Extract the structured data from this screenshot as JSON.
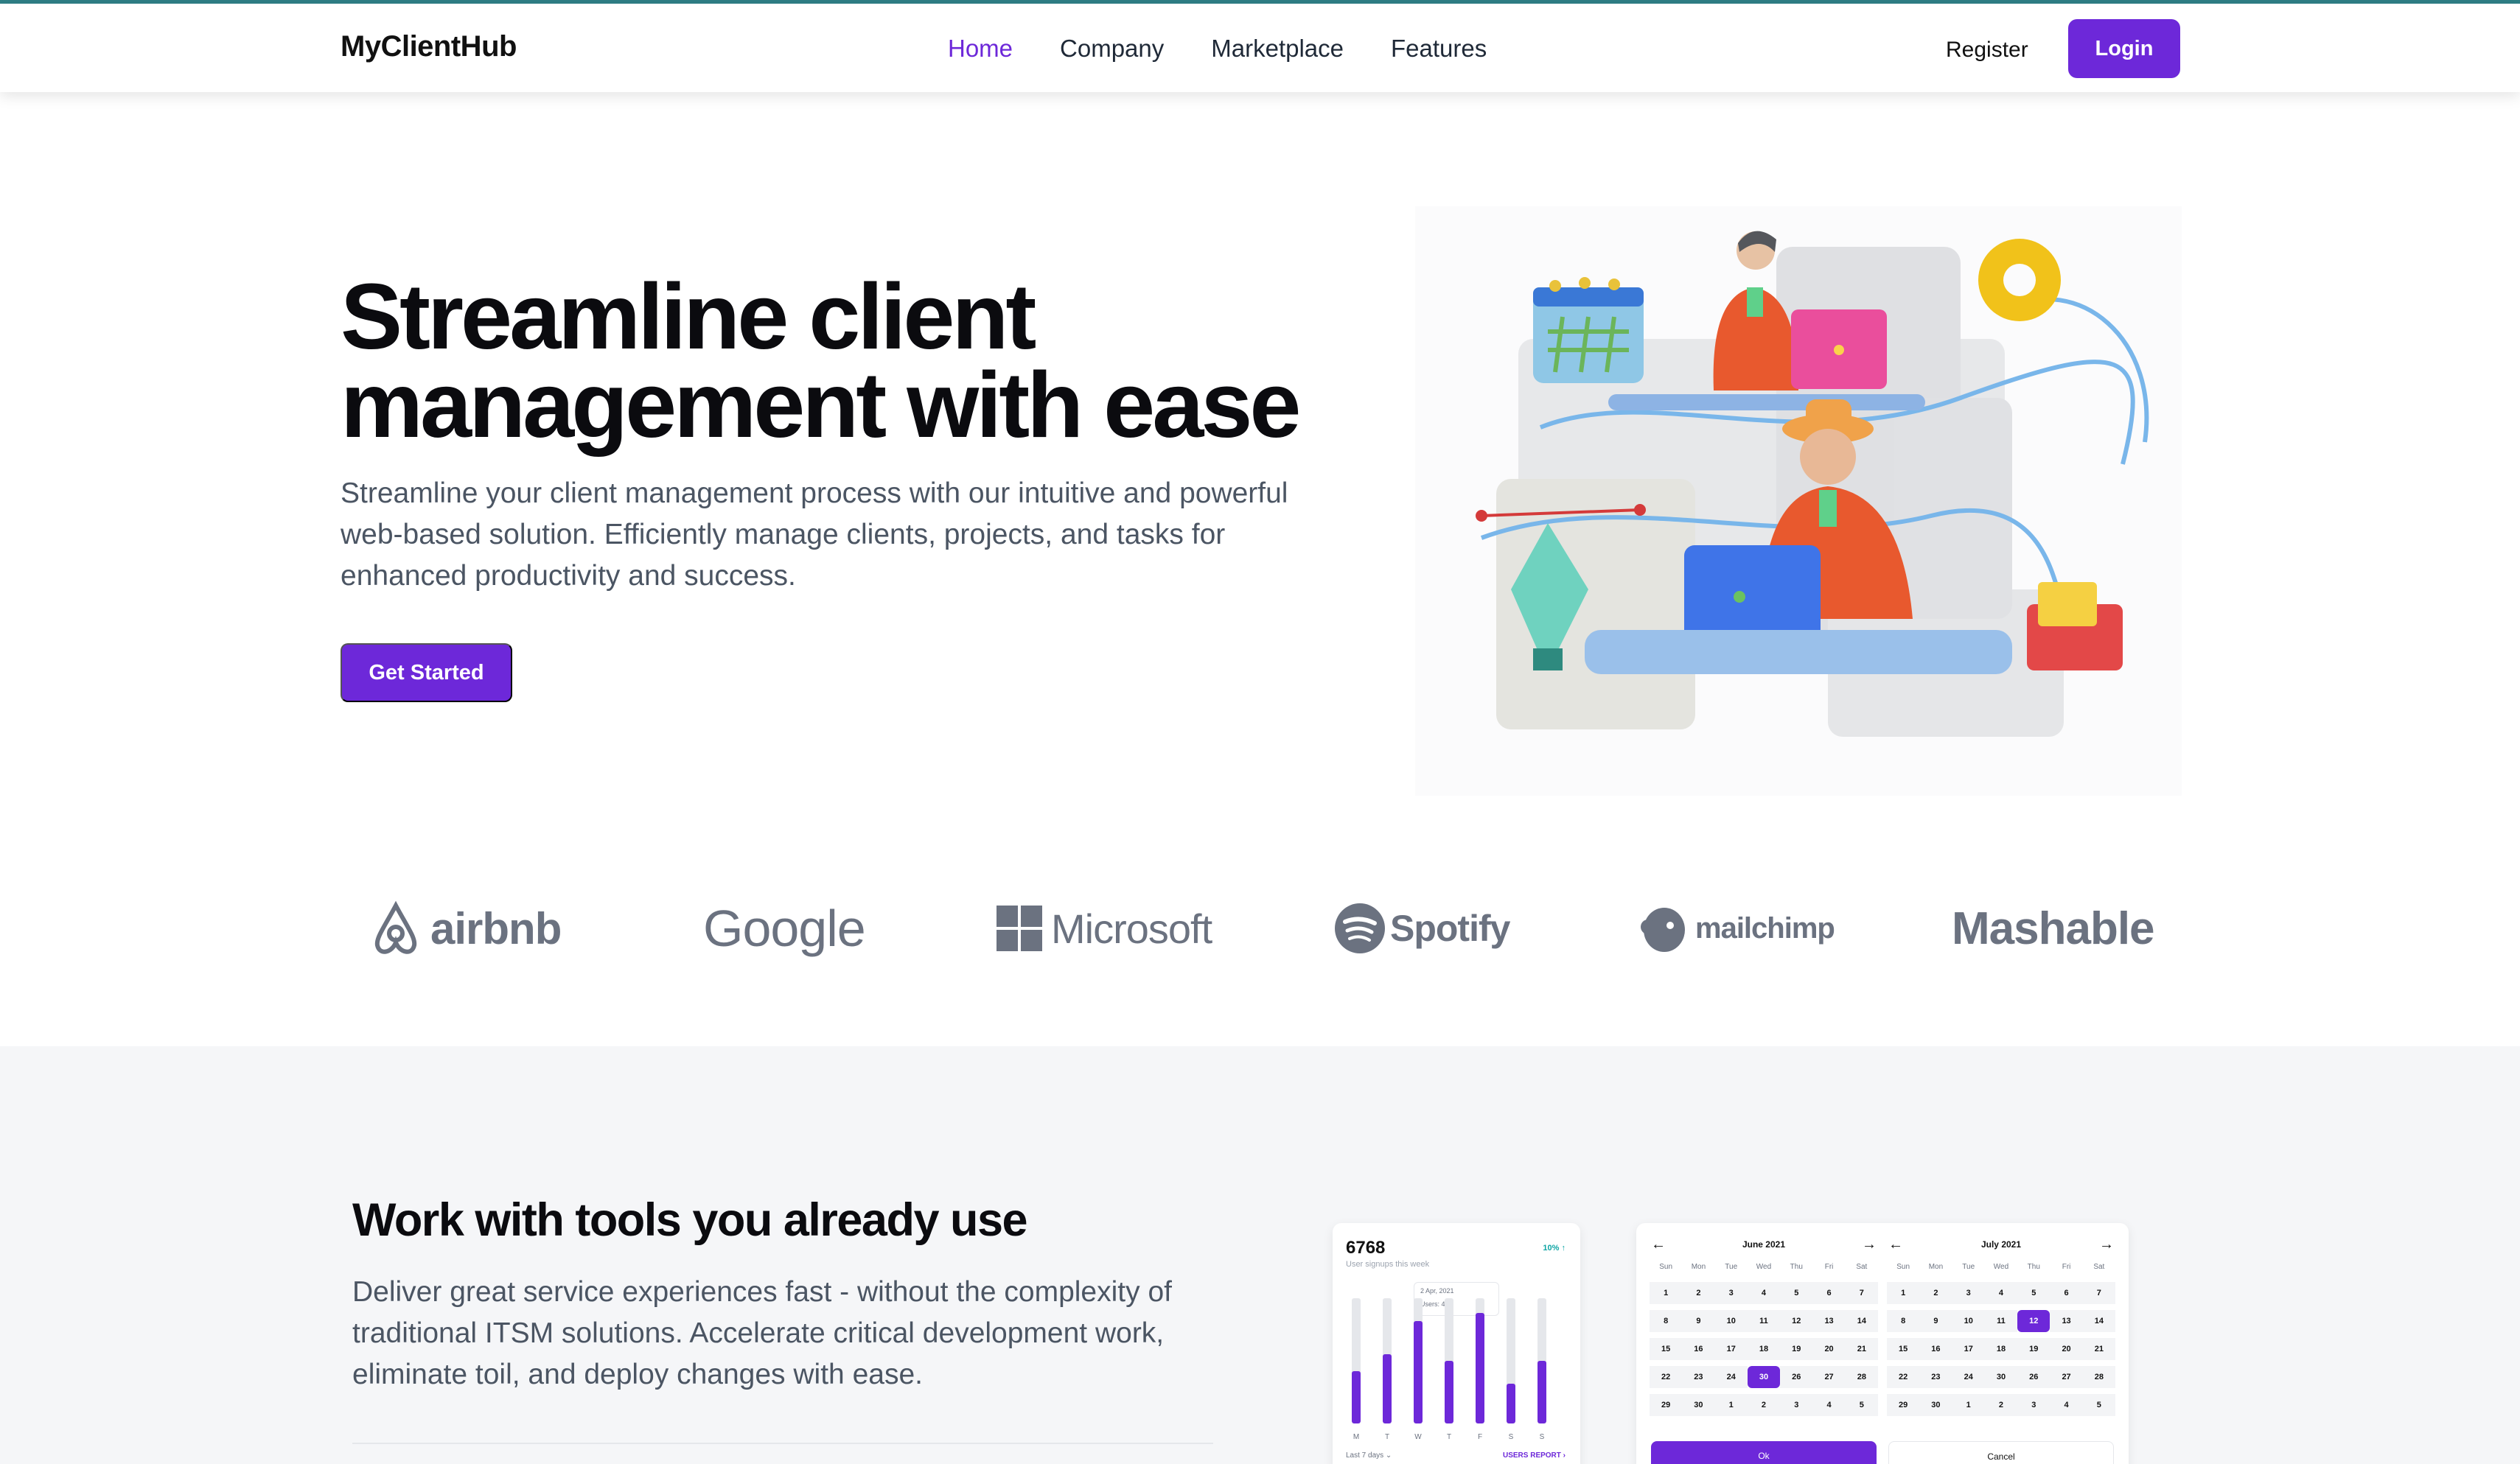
{
  "nav": {
    "brand": "MyClientHub",
    "links": [
      "Home",
      "Company",
      "Marketplace",
      "Features"
    ],
    "active_link": "Home",
    "register": "Register",
    "login": "Login"
  },
  "hero": {
    "title_line1": "Streamline client",
    "title_line2": "management with ease",
    "subtitle": "Streamline your client management process with our intuitive and powerful web-based solution. Efficiently manage clients, projects, and tasks for enhanced productivity and success.",
    "cta": "Get Started"
  },
  "logos": [
    "airbnb",
    "Google",
    "Microsoft",
    "Spotify",
    "mailchimp",
    "Mashable"
  ],
  "section2": {
    "title": "Work with tools you already use",
    "subtitle": "Deliver great service experiences fast - without the complexity of traditional ITSM solutions. Accelerate critical development work, eliminate toil, and deploy changes with ease."
  },
  "stats_card": {
    "value": "6768",
    "label": "User signups this week",
    "change": "10% ↑",
    "tooltip_date": "2 Apr, 2021",
    "tooltip_value": "Users: 40",
    "days": [
      "M",
      "T",
      "W",
      "T",
      "F",
      "S",
      "S"
    ],
    "bar_levels": [
      0.42,
      0.55,
      0.82,
      0.5,
      0.88,
      0.32,
      0.5
    ],
    "footer_left": "Last 7 days ⌄",
    "footer_right": "USERS REPORT ›"
  },
  "calendar": {
    "day_names": [
      "Sun",
      "Mon",
      "Tue",
      "Wed",
      "Thu",
      "Fri",
      "Sat"
    ],
    "left": {
      "month": "June 2021",
      "days": [
        "1",
        "2",
        "3",
        "4",
        "5",
        "6",
        "7",
        "8",
        "9",
        "10",
        "11",
        "12",
        "13",
        "14",
        "15",
        "16",
        "17",
        "18",
        "19",
        "20",
        "21",
        "22",
        "23",
        "24",
        "30",
        "26",
        "27",
        "28",
        "29",
        "30",
        "1",
        "2",
        "3",
        "4",
        "5"
      ],
      "selected": "30"
    },
    "right": {
      "month": "July 2021",
      "days": [
        "1",
        "2",
        "3",
        "4",
        "5",
        "6",
        "7",
        "8",
        "9",
        "10",
        "11",
        "12",
        "13",
        "14",
        "15",
        "16",
        "17",
        "18",
        "19",
        "20",
        "21",
        "22",
        "23",
        "24",
        "30",
        "26",
        "27",
        "28",
        "29",
        "30",
        "1",
        "2",
        "3",
        "4",
        "5"
      ],
      "selected": "12"
    },
    "ok": "Ok",
    "cancel": "Cancel"
  },
  "colors": {
    "accent": "#6d28d9",
    "top_line": "#2f7f86",
    "logo_gray": "#6b7280"
  }
}
